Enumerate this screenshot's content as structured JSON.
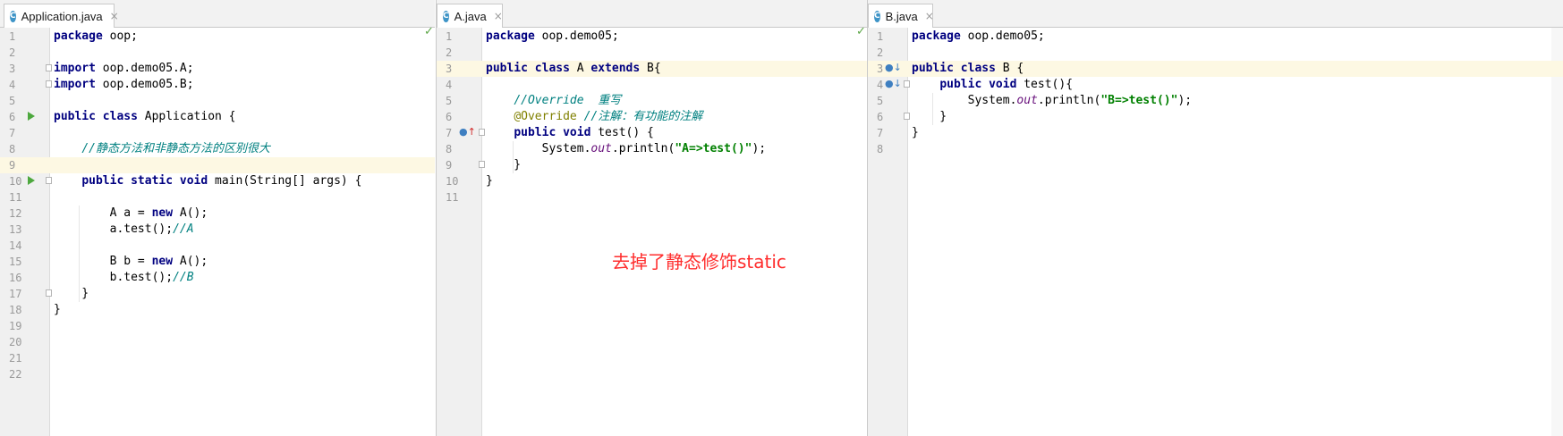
{
  "panes": [
    {
      "tab": {
        "title": "Application.java",
        "icon_letter": "C",
        "close": "×"
      },
      "status": "✓",
      "lines": [
        {
          "no": "1",
          "tokens": [
            {
              "t": "package",
              "c": "kw"
            },
            {
              "t": " oop;"
            }
          ]
        },
        {
          "no": "2",
          "tokens": []
        },
        {
          "no": "3",
          "tokens": [
            {
              "t": "import",
              "c": "kw"
            },
            {
              "t": " oop.demo05.A;"
            }
          ],
          "fold": true
        },
        {
          "no": "4",
          "tokens": [
            {
              "t": "import",
              "c": "kw"
            },
            {
              "t": " oop.demo05.B;"
            }
          ],
          "fold": true
        },
        {
          "no": "5",
          "tokens": []
        },
        {
          "no": "6",
          "tokens": [
            {
              "t": "public class",
              "c": "kw"
            },
            {
              "t": " Application {"
            }
          ],
          "run": true
        },
        {
          "no": "7",
          "tokens": []
        },
        {
          "no": "8",
          "tokens": [
            {
              "t": "    "
            },
            {
              "t": "//静态方法和非静态方法的区别很大",
              "c": "cm"
            }
          ]
        },
        {
          "no": "9",
          "tokens": [],
          "hl": true
        },
        {
          "no": "10",
          "tokens": [
            {
              "t": "    "
            },
            {
              "t": "public static void",
              "c": "kw"
            },
            {
              "t": " main(String[] args) {"
            }
          ],
          "run": true,
          "fold": true
        },
        {
          "no": "11",
          "tokens": []
        },
        {
          "no": "12",
          "tokens": [
            {
              "t": "        A a = "
            },
            {
              "t": "new",
              "c": "kw"
            },
            {
              "t": " A();"
            }
          ]
        },
        {
          "no": "13",
          "tokens": [
            {
              "t": "        a.test();"
            },
            {
              "t": "//A",
              "c": "cm"
            }
          ]
        },
        {
          "no": "14",
          "tokens": []
        },
        {
          "no": "15",
          "tokens": [
            {
              "t": "        B b = "
            },
            {
              "t": "new",
              "c": "kw"
            },
            {
              "t": " A();"
            }
          ]
        },
        {
          "no": "16",
          "tokens": [
            {
              "t": "        b.test();"
            },
            {
              "t": "//B",
              "c": "cm"
            }
          ]
        },
        {
          "no": "17",
          "tokens": [
            {
              "t": "    }"
            }
          ],
          "fold": true
        },
        {
          "no": "18",
          "tokens": [
            {
              "t": "}"
            }
          ]
        },
        {
          "no": "19",
          "tokens": []
        },
        {
          "no": "20",
          "tokens": []
        },
        {
          "no": "21",
          "tokens": []
        },
        {
          "no": "22",
          "tokens": []
        }
      ]
    },
    {
      "tab": {
        "title": "A.java",
        "icon_letter": "C",
        "close": "×"
      },
      "status": "✓",
      "lines": [
        {
          "no": "1",
          "tokens": [
            {
              "t": "package",
              "c": "kw"
            },
            {
              "t": " oop.demo05;"
            }
          ]
        },
        {
          "no": "2",
          "tokens": []
        },
        {
          "no": "3",
          "tokens": [
            {
              "t": "public class",
              "c": "kw"
            },
            {
              "t": " A "
            },
            {
              "t": "extends",
              "c": "kw"
            },
            {
              "t": " B{"
            }
          ],
          "hl": true
        },
        {
          "no": "4",
          "tokens": []
        },
        {
          "no": "5",
          "tokens": [
            {
              "t": "    "
            },
            {
              "t": "//Override  重写",
              "c": "cm"
            }
          ]
        },
        {
          "no": "6",
          "tokens": [
            {
              "t": "    "
            },
            {
              "t": "@Override",
              "c": "an"
            },
            {
              "t": " "
            },
            {
              "t": "//注解：有功能的注解",
              "c": "cm"
            }
          ]
        },
        {
          "no": "7",
          "tokens": [
            {
              "t": "    "
            },
            {
              "t": "public void",
              "c": "kw"
            },
            {
              "t": " test() {"
            }
          ],
          "impl": "up",
          "fold": true
        },
        {
          "no": "8",
          "tokens": [
            {
              "t": "        System."
            },
            {
              "t": "out",
              "c": "fld"
            },
            {
              "t": ".println("
            },
            {
              "t": "\"A=>test()\"",
              "c": "st"
            },
            {
              "t": ");"
            }
          ]
        },
        {
          "no": "9",
          "tokens": [
            {
              "t": "    }"
            }
          ],
          "fold": true
        },
        {
          "no": "10",
          "tokens": [
            {
              "t": "}"
            }
          ]
        },
        {
          "no": "11",
          "tokens": []
        }
      ]
    },
    {
      "tab": {
        "title": "B.java",
        "icon_letter": "C",
        "close": "×"
      },
      "status": "",
      "lines": [
        {
          "no": "1",
          "tokens": [
            {
              "t": "package",
              "c": "kw"
            },
            {
              "t": " oop.demo05;"
            }
          ]
        },
        {
          "no": "2",
          "tokens": []
        },
        {
          "no": "3",
          "tokens": [
            {
              "t": "public class",
              "c": "kw"
            },
            {
              "t": " B {"
            }
          ],
          "hl": true,
          "impl": "down"
        },
        {
          "no": "4",
          "tokens": [
            {
              "t": "    "
            },
            {
              "t": "public void",
              "c": "kw"
            },
            {
              "t": " test(){"
            }
          ],
          "impl": "down",
          "fold": true
        },
        {
          "no": "5",
          "tokens": [
            {
              "t": "        System."
            },
            {
              "t": "out",
              "c": "fld"
            },
            {
              "t": ".println("
            },
            {
              "t": "\"B=>test()\"",
              "c": "st"
            },
            {
              "t": ");"
            }
          ]
        },
        {
          "no": "6",
          "tokens": [
            {
              "t": "    }"
            }
          ],
          "fold": true
        },
        {
          "no": "7",
          "tokens": [
            {
              "t": "}"
            }
          ]
        },
        {
          "no": "8",
          "tokens": []
        }
      ]
    }
  ],
  "annotation_note": "去掉了静态修饰static",
  "colors": {
    "keyword": "#000080",
    "comment": "#008080",
    "string": "#008000",
    "annotation": "#808000",
    "note": "#ff2d2d"
  },
  "icons": {
    "run": "run-gutter-icon",
    "implements_up": "overrides-up-icon",
    "implements_down": "implemented-down-icon",
    "check": "inspection-ok-icon"
  }
}
